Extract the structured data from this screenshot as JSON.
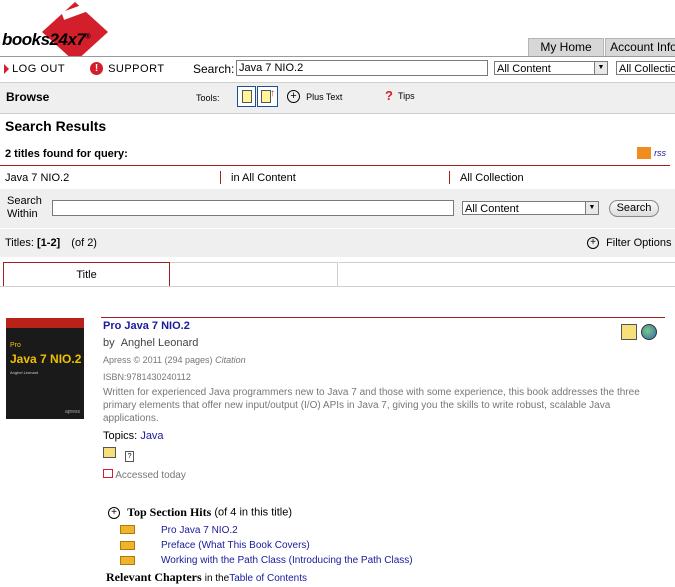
{
  "logo": {
    "brand": "books24x7",
    "mark": "®"
  },
  "tabs": {
    "my_home": "My Home",
    "account_info": "Account Info"
  },
  "toolbar": {
    "logout": "LOG OUT",
    "support": "SUPPORT",
    "search_label": "Search:",
    "search_value": "Java 7 NIO.2",
    "scope_select": "All Content",
    "collection_select": "All Collections"
  },
  "browse": {
    "label": "Browse",
    "tools_label": "Tools:",
    "plus_text": "Plus Text",
    "tips": "Tips"
  },
  "results": {
    "heading": "Search Results",
    "found_text": "2 titles found for query:",
    "rss": "rss",
    "query": "Java 7 NIO.2",
    "in_content": "in All Content",
    "in_collection": "All Collection",
    "search_within_label": "Search Within",
    "search_within_value": "",
    "search_within_scope": "All Content",
    "search_button": "Search",
    "titles_label": "Titles:",
    "titles_range": "[1-2]",
    "titles_total": "(of 2)",
    "filter_options": "Filter Options",
    "column_title": "Title"
  },
  "book": {
    "title": "Pro Java 7 NIO.2",
    "by": "by",
    "author": "Anghel Leonard",
    "publisher": "Apress",
    "copyright": "© 2011 (294 pages)",
    "citation": "Citation",
    "isbn": "ISBN:9781430240112",
    "description": "Written for experienced Java programmers new to Java 7 and those with some experience, this book addresses the three primary elements that offer new input/output (I/O) APIs in Java 7, giving you the skills to write robust, scalable Java applications.",
    "topics_label": "Topics:",
    "topic": "Java",
    "accessed": "Accessed today",
    "cover": {
      "line1": "Pro",
      "line2": "Java 7 NIO.2",
      "author": "Anghel Leonard",
      "publisher": "apress"
    }
  },
  "hits": {
    "heading": "Top Section Hits",
    "count": "(of 4 in this title)",
    "items": [
      "Pro Java 7 NIO.2",
      "Preface (What This Book Covers)",
      "Working with the Path Class (Introducing the Path Class)"
    ],
    "relevant_label": "Relevant Chapters",
    "relevant_in": "in the",
    "toc_link": "Table of Contents"
  },
  "colors": {
    "brand_red": "#d21f2b",
    "rule_red": "#a02020",
    "link_blue": "#1a1a9c"
  }
}
